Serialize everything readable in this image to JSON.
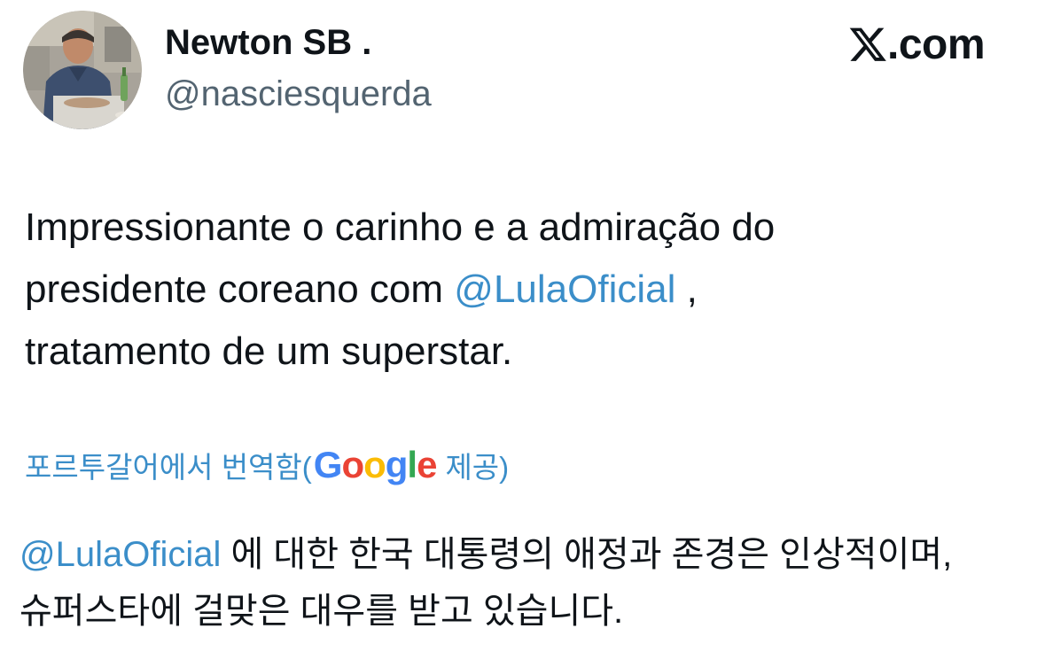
{
  "author": {
    "display_name": "Newton SB .",
    "handle": "@nasciesquerda",
    "avatar_icon": "profile-photo"
  },
  "brand": {
    "x_icon": "x-logo-icon",
    "domain_suffix": ".com"
  },
  "tweet": {
    "line1": "Impressionante o carinho e a admiração do",
    "line2_pre": "presidente coreano com ",
    "line2_mention": "@LulaOficial",
    "line2_post": " ,",
    "line3": "tratamento de um superstar."
  },
  "translation_bar": {
    "prefix": "포르투갈어에서 번역함(",
    "provider_letters": [
      "G",
      "o",
      "o",
      "g",
      "l",
      "e"
    ],
    "provider_colors": [
      "#4285F4",
      "#EA4335",
      "#FBBC05",
      "#4285F4",
      "#34A853",
      "#EA4335"
    ],
    "suffix": " 제공)"
  },
  "translated_text": {
    "line1_mention": "@LulaOficial",
    "line1_rest": " 에 대한 한국 대통령의 애정과 존경은 인상적이며,",
    "line2": "슈퍼스타에 걸맞은 대우를 받고 있습니다."
  },
  "colors": {
    "link": "#3b8ec9",
    "text": "#0f1419",
    "secondary": "#536471"
  }
}
